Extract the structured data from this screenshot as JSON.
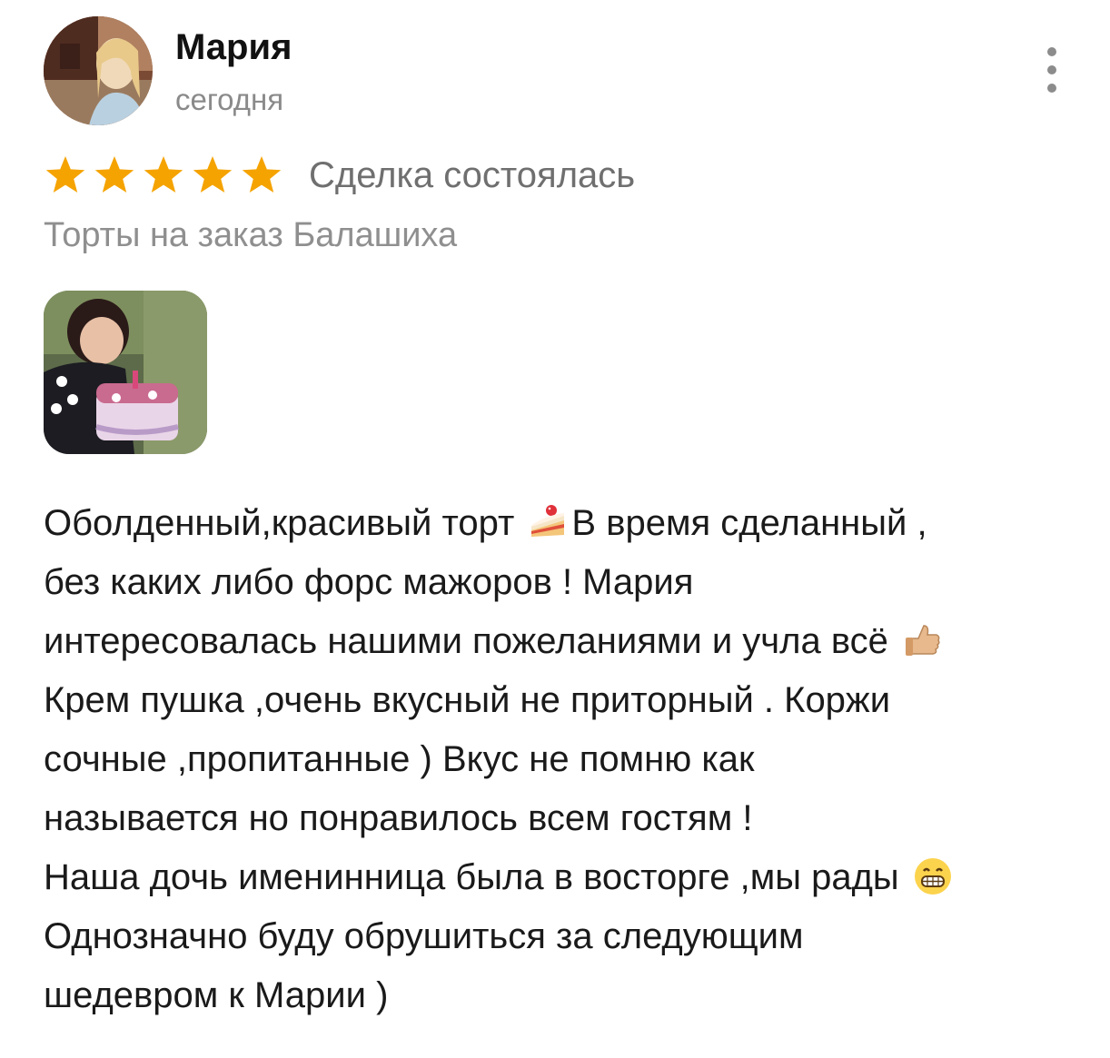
{
  "author": {
    "name": "Мария",
    "date": "сегодня",
    "avatar_icon": "user-avatar-photo"
  },
  "menu": {
    "icon": "more-vertical-icon"
  },
  "rating": {
    "stars": 5,
    "max": 5,
    "star_color": "#F5A300",
    "deal_status": "Сделка состоялась"
  },
  "category": "Торты на заказ Балашиха",
  "photo": {
    "icon": "review-photo-thumbnail"
  },
  "review": {
    "lines": [
      {
        "before": "Оболденный,красивый торт ",
        "emoji": "cake-icon",
        "after": "В время сделанный ,"
      },
      {
        "before": "без каких либо  форс мажоров ! Мария",
        "emoji": "",
        "after": ""
      },
      {
        "before": "интересовалась нашими пожеланиями и учла всё ",
        "emoji": "thumbs-up-icon",
        "after": ""
      },
      {
        "before": "Крем пушка ,очень вкусный не приторный . Коржи",
        "emoji": "",
        "after": ""
      },
      {
        "before": "сочные ,пропитанные ) Вкус не помню как",
        "emoji": "",
        "after": ""
      },
      {
        "before": "называется но понравилось всем гостям !",
        "emoji": "",
        "after": ""
      },
      {
        "before": "Наша дочь именинница была в восторге ,мы рады ",
        "emoji": "grinning-face-icon",
        "after": ""
      },
      {
        "before": "Однозначно буду обрушиться за следующим",
        "emoji": "",
        "after": ""
      },
      {
        "before": "шедевром к Марии )",
        "emoji": "",
        "after": ""
      }
    ]
  }
}
